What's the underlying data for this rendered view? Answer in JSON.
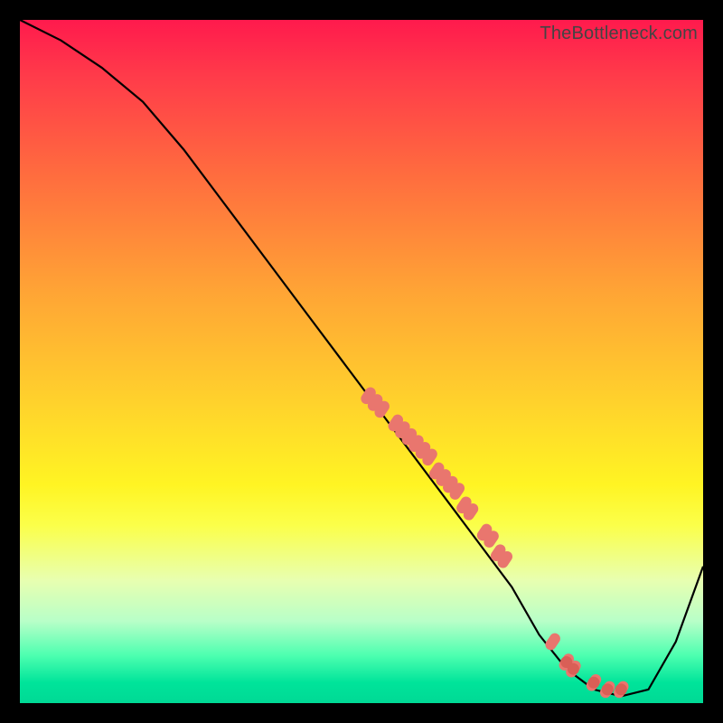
{
  "watermark": "TheBottleneck.com",
  "chart_data": {
    "type": "line",
    "title": "",
    "xlabel": "",
    "ylabel": "",
    "xlim": [
      0,
      100
    ],
    "ylim": [
      0,
      100
    ],
    "grid": false,
    "legend": false,
    "series": [
      {
        "name": "curve",
        "color": "#000000",
        "x": [
          0,
          6,
          12,
          18,
          24,
          30,
          36,
          42,
          48,
          54,
          60,
          66,
          72,
          76,
          80,
          84,
          88,
          92,
          96,
          100
        ],
        "values": [
          100,
          97,
          93,
          88,
          81,
          73,
          65,
          57,
          49,
          41,
          33,
          25,
          17,
          10,
          5,
          2,
          1,
          2,
          9,
          20
        ]
      }
    ],
    "scatter": [
      {
        "name": "points-on-curve",
        "color": "#e9766e",
        "x": [
          51,
          52,
          53,
          55,
          56,
          57,
          58,
          59,
          60,
          61,
          62,
          63,
          64,
          65,
          66,
          68,
          69,
          70,
          71,
          78,
          80,
          81,
          84,
          86,
          88
        ],
        "y": [
          45,
          44,
          43,
          41,
          40,
          39,
          38,
          37,
          36,
          34,
          33,
          32,
          31,
          29,
          28,
          25,
          24,
          22,
          21,
          9,
          6,
          5,
          3,
          2,
          2
        ]
      }
    ]
  }
}
